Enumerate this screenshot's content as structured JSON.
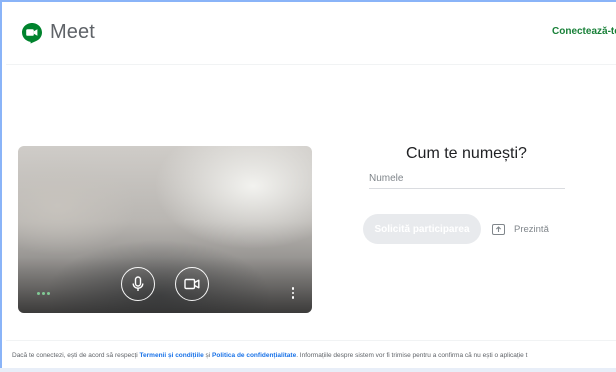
{
  "header": {
    "app_name": "Meet",
    "sign_in": "Conectează-te"
  },
  "preview": {
    "mic_icon": "microphone-icon",
    "camera_icon": "videocam-icon",
    "menu_icon": "more-vert-icon",
    "effects_icon": "more-horiz-icon"
  },
  "join": {
    "title": "Cum te numești?",
    "name_placeholder": "Numele",
    "name_value": "",
    "ask_button": "Solicită participarea",
    "present_button": "Prezintă",
    "present_icon": "present-to-all-icon"
  },
  "footer": {
    "text_before": "Dacă te conectezi, ești de acord să respecți ",
    "terms_link": "Termenii și condițiile",
    "text_and": " și ",
    "privacy_link": "Politica de confidențialitate",
    "text_after": ". Informațiile despre sistem vor fi trimise pentru a confirma că nu ești o aplicație t"
  },
  "colors": {
    "brand_green": "#188038",
    "link_blue": "#1a73e8",
    "disabled_button": "#e8eaed",
    "frame_border": "#8ab4f8"
  }
}
